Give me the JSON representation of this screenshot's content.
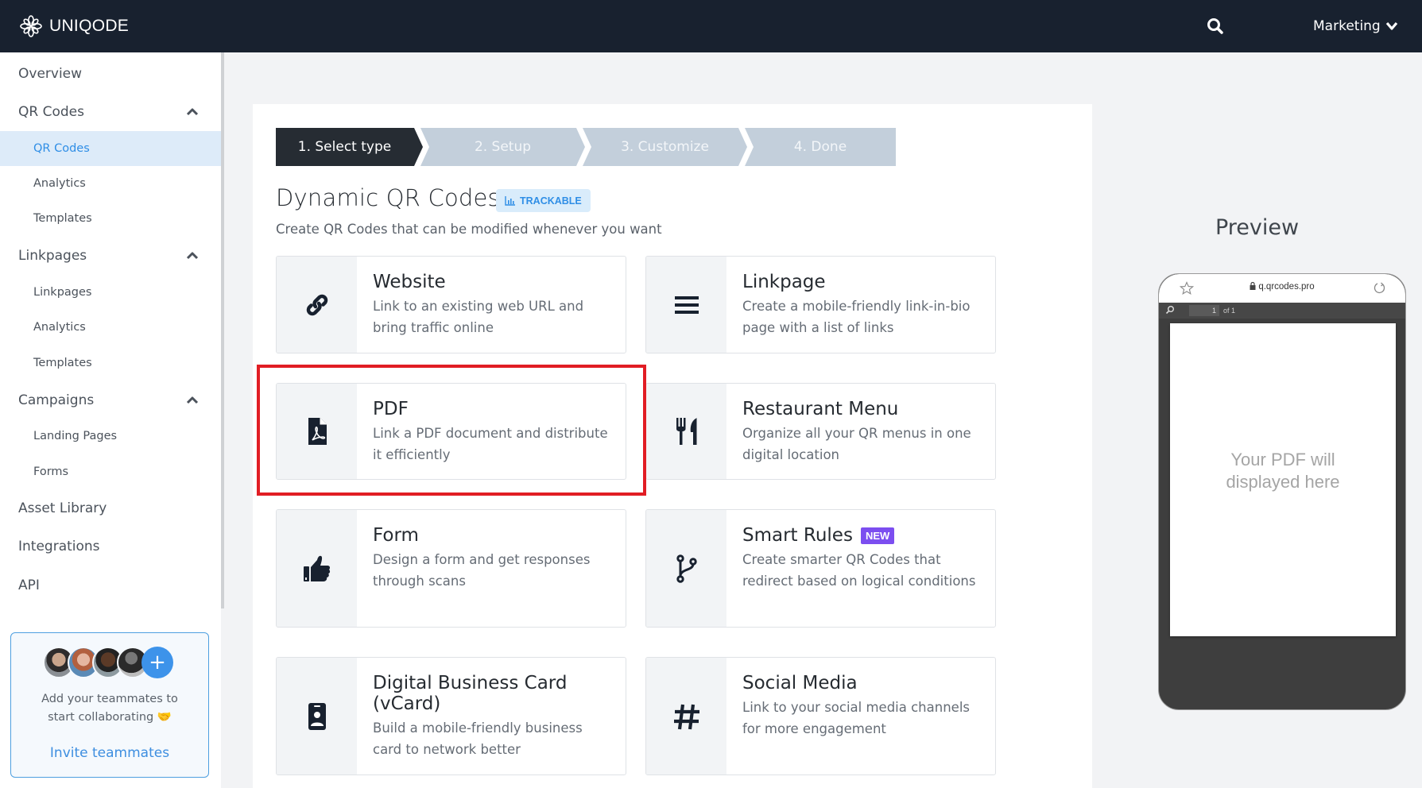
{
  "header": {
    "brand": "UNIQODE",
    "logo_icon": "flower-logo-icon",
    "search_icon": "search-icon",
    "workspace": "Marketing",
    "workspace_icon": "chevron-down-icon"
  },
  "sidebar": {
    "items": [
      {
        "label": "Overview",
        "level": "top"
      },
      {
        "label": "QR Codes",
        "level": "top",
        "expanded": true
      },
      {
        "label": "QR Codes",
        "level": "sub",
        "active": true
      },
      {
        "label": "Analytics",
        "level": "sub"
      },
      {
        "label": "Templates",
        "level": "sub"
      },
      {
        "label": "Linkpages",
        "level": "top",
        "expanded": true
      },
      {
        "label": "Linkpages",
        "level": "sub"
      },
      {
        "label": "Analytics",
        "level": "sub"
      },
      {
        "label": "Templates",
        "level": "sub"
      },
      {
        "label": "Campaigns",
        "level": "top",
        "expanded": true
      },
      {
        "label": "Landing Pages",
        "level": "sub"
      },
      {
        "label": "Forms",
        "level": "sub"
      },
      {
        "label": "Asset Library",
        "level": "top"
      },
      {
        "label": "Integrations",
        "level": "top"
      },
      {
        "label": "API",
        "level": "top"
      }
    ],
    "invite": {
      "text_line1": "Add your teammates to",
      "text_line2": "start collaborating 🤝",
      "link": "Invite teammates",
      "avatar_count": 4,
      "plus": "+"
    }
  },
  "steps": [
    {
      "label": "1. Select type",
      "active": true
    },
    {
      "label": "2. Setup",
      "active": false
    },
    {
      "label": "3. Customize",
      "active": false
    },
    {
      "label": "4. Done",
      "active": false
    }
  ],
  "main": {
    "title": "Dynamic QR Codes",
    "badge": "TRACKABLE",
    "subtitle": "Create QR Codes that can be modified whenever you want",
    "cards": [
      {
        "title": "Website",
        "desc": "Link to an existing web URL and bring traffic online",
        "icon": "link-icon"
      },
      {
        "title": "Linkpage",
        "desc": "Create a mobile-friendly link-in-bio page with a list of links",
        "icon": "menu-lines-icon"
      },
      {
        "title": "PDF",
        "desc": "Link a PDF document and distribute it efficiently",
        "icon": "pdf-file-icon",
        "highlighted": true
      },
      {
        "title": "Restaurant Menu",
        "desc": "Organize all your QR menus in one digital location",
        "icon": "utensils-icon"
      },
      {
        "title": "Form",
        "desc": "Design a form and get responses through scans",
        "icon": "thumbs-up-icon"
      },
      {
        "title": "Smart Rules",
        "badge": "NEW",
        "desc": "Create smarter QR Codes that redirect based on logical conditions",
        "icon": "branch-icon"
      },
      {
        "title": "Digital Business Card (vCard)",
        "desc": "Build a mobile-friendly business card to network better",
        "icon": "id-badge-icon"
      },
      {
        "title": "Social Media",
        "desc": "Link to your social media channels for more engagement",
        "icon": "hashtag-icon"
      }
    ]
  },
  "preview": {
    "title": "Preview",
    "url": "q.qrcodes.pro",
    "page_current": "1",
    "page_of": "of 1",
    "placeholder_line1": "Your PDF will",
    "placeholder_line2": "displayed here"
  },
  "colors": {
    "header_bg": "#18212f",
    "accent_blue": "#2f8ee6",
    "step_active": "#262c33",
    "step_inactive": "#c3cfdb",
    "highlight_red": "#e11d24",
    "new_badge": "#7c4ef0"
  }
}
